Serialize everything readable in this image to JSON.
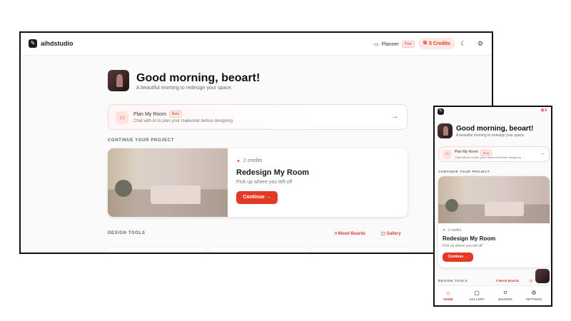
{
  "app": {
    "brand": "aihdstudio"
  },
  "topbar": {
    "planner_label": "Planner",
    "planner_badge": "Free",
    "credits_label": "5 Credits",
    "credits_short": "5"
  },
  "greeting": {
    "title": "Good morning, beoart!",
    "subtitle": "A beautiful morning to redesign your space."
  },
  "plan": {
    "title": "Plan My Room",
    "badge": "Beta",
    "description": "Chat with AI to plan your makeover before designing",
    "arrow": "→"
  },
  "continue_section": {
    "heading": "CONTINUE YOUR PROJECT"
  },
  "project": {
    "credits": "2 credits",
    "title": "Redesign My Room",
    "subtitle": "Pick up where you left off",
    "button": "Continue →"
  },
  "tools_section": {
    "heading": "DESIGN TOOLS",
    "mood_boards": "Mood Boards",
    "gallery": "Gallery"
  },
  "mobile_nav": {
    "items": [
      {
        "label": "HOME",
        "icon": "⌂"
      },
      {
        "label": "GALLERY",
        "icon": "▢"
      },
      {
        "label": "BOARDS",
        "icon": "⌑"
      },
      {
        "label": "SETTINGS",
        "icon": "⚙"
      }
    ]
  },
  "colors": {
    "accent": "#e23a26",
    "accent_soft": "#fde8e5"
  }
}
